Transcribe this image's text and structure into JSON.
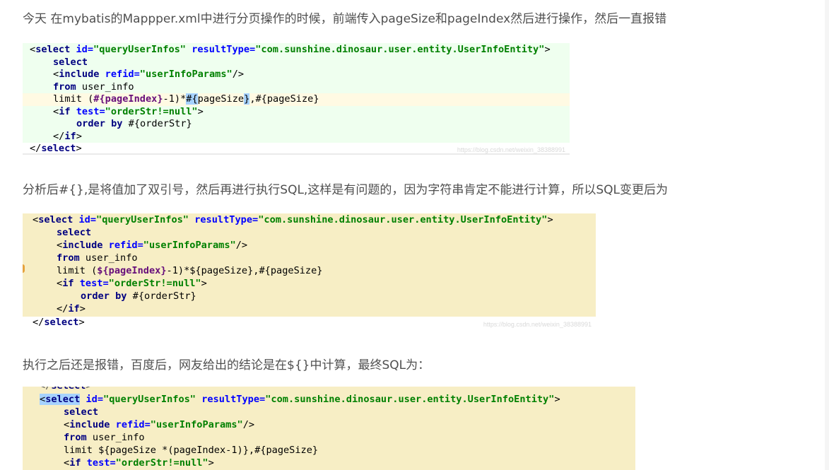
{
  "paragraphs": [
    "今天 在mybatis的Mappper.xml中进行分页操作的时候，前端传入pageSize和pageIndex然后进行操作，然后一直报错",
    "分析后#{},是将值加了双引号，然后再进行执行SQL,这样是有问题的，因为字符串肯定不能进行计算，所以SQL变更后为",
    "执行之后还是报错，百度后，网友给出的结论是在${}中计算，最终SQL为："
  ],
  "snippets": [
    {
      "watermark": "https://blog.csdn.net/weixin_38388991",
      "lines": [
        "<select id=\"queryUserInfos\" resultType=\"com.sunshine.dinosaur.user.entity.UserInfoEntity\">",
        "    select",
        "    <include refid=\"userInfoParams\"/>",
        "    from user_info",
        "    limit (#{pageIndex}-1)*#{pageSize},#{pageSize}",
        "    <if test=\"orderStr!=null\">",
        "        order by #{orderStr}",
        "    </if>",
        "</select>"
      ]
    },
    {
      "watermark": "https://blog.csdn.net/weixin_38388991",
      "lines": [
        "<select id=\"queryUserInfos\" resultType=\"com.sunshine.dinosaur.user.entity.UserInfoEntity\">",
        "    select",
        "    <include refid=\"userInfoParams\"/>",
        "    from user_info",
        "    limit (${pageIndex}-1)*${pageSize},#{pageSize}",
        "    <if test=\"orderStr!=null\">",
        "        order by #{orderStr}",
        "    </if>",
        "</select>"
      ]
    },
    {
      "partial_top": "</select>",
      "lines": [
        "<select id=\"queryUserInfos\" resultType=\"com.sunshine.dinosaur.user.entity.UserInfoEntity\">",
        "    select",
        "    <include refid=\"userInfoParams\"/>",
        "    from user_info",
        "    limit ${pageSize *(pageIndex-1)},#{pageSize}",
        "    <if test=\"orderStr!=null\">"
      ]
    }
  ]
}
